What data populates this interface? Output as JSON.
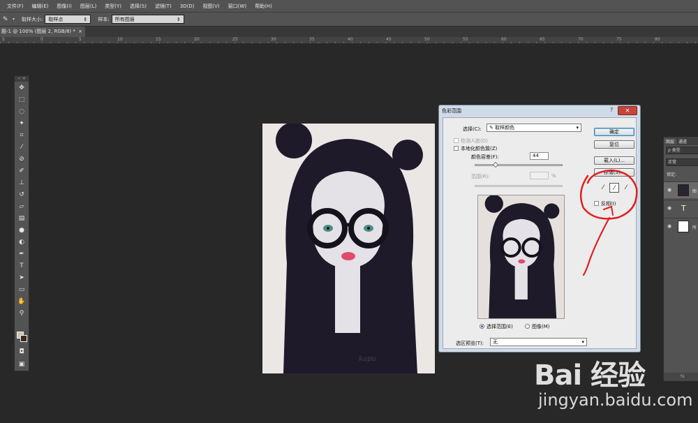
{
  "menubar": {
    "items": [
      "文件(F)",
      "编辑(E)",
      "图像(I)",
      "图层(L)",
      "类型(Y)",
      "选择(S)",
      "滤镜(T)",
      "3D(D)",
      "视图(V)",
      "窗口(W)",
      "帮助(H)"
    ]
  },
  "options": {
    "sample_size_label": "取样大小:",
    "sample_size_value": "取样点",
    "sample_label": "样本:",
    "sample_value": "所有图层"
  },
  "document_tab": {
    "title": "题-1 @ 100% (图层 2, RGB/8) *",
    "close": "×"
  },
  "ruler": {
    "ticks": [
      "5",
      "0",
      "5",
      "10",
      "15",
      "20",
      "25",
      "30",
      "35",
      "40",
      "45",
      "50",
      "55",
      "60",
      "65",
      "70",
      "75",
      "80"
    ]
  },
  "colors": {
    "foreground": "#cfc2ae",
    "background": "#3a2a1c",
    "annotation": "#e02020"
  },
  "dialog": {
    "title": "色彩范围",
    "help": "?",
    "close": "✕",
    "select_label": "选择(C):",
    "select_value": "取样颜色",
    "detect_faces": "检测人脸(D)",
    "localized": "本地化颜色簇(Z)",
    "fuzziness_label": "颜色容差(F):",
    "fuzziness_value": "44",
    "range_label": "范围(R):",
    "range_unit": "%",
    "ok": "确定",
    "reset": "复位",
    "load": "载入(L)...",
    "save": "存储(S)...",
    "invert": "反相(I)",
    "radio_selection": "选择范围(E)",
    "radio_image": "图像(M)",
    "preview_label": "选区预览(T):",
    "preview_value": "无",
    "preview_artist_signature": "kapu"
  },
  "layers_panel": {
    "tab_layers": "图层",
    "tab_channels": "通道",
    "search_placeholder": "ρ 类型",
    "blend_mode": "正常",
    "lock_label": "锁定:",
    "rows": [
      {
        "name": "图"
      },
      {
        "name": "T"
      },
      {
        "name": "所"
      }
    ],
    "footer": "fx"
  },
  "watermark": {
    "logo": "Bai 经验",
    "url": "jingyan.baidu.com"
  }
}
